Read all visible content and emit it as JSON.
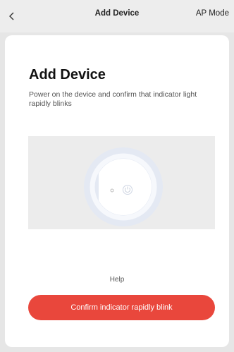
{
  "nav": {
    "title": "Add Device",
    "ap_mode_label": "AP Mode"
  },
  "card": {
    "heading": "Add Device",
    "description": "Power on the device and confirm that indicator light rapidly blinks",
    "help_label": "Help",
    "confirm_label": "Confirm indicator rapidly blink"
  },
  "icons": {
    "back": "chevron-left-icon",
    "power": "power-icon"
  },
  "colors": {
    "accent": "#e9473c",
    "background": "#e6e6e6",
    "illustration_bg": "#ececec"
  }
}
